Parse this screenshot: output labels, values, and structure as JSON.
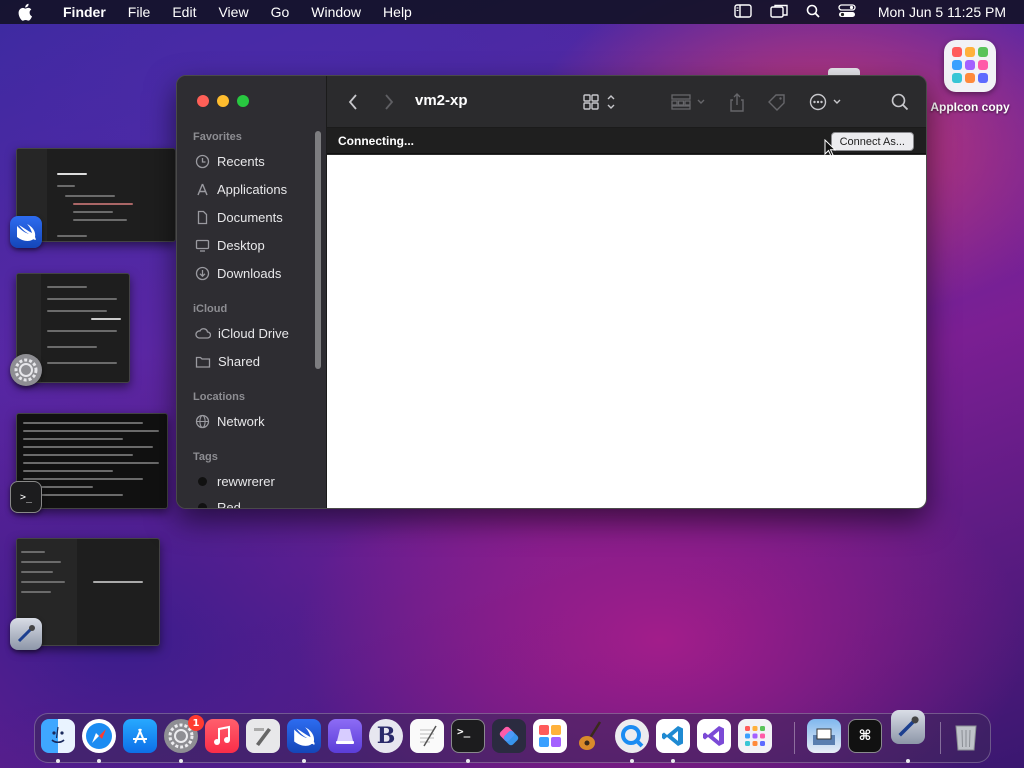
{
  "menubar": {
    "app_name": "Finder",
    "menus": [
      "File",
      "Edit",
      "View",
      "Go",
      "Window",
      "Help"
    ],
    "status_icons": [
      "sidebar-icon",
      "screen-mirror-icon",
      "search-icon",
      "control-center-icon"
    ],
    "clock": "Mon Jun 5  11:25 PM"
  },
  "desktop": {
    "icon_label": "AppIcon copy"
  },
  "finder": {
    "title": "vm2-xp",
    "sidebar": {
      "favorites_heading": "Favorites",
      "favorites": [
        {
          "label": "Recents",
          "icon": "clock-icon"
        },
        {
          "label": "Applications",
          "icon": "applications-icon"
        },
        {
          "label": "Documents",
          "icon": "document-icon"
        },
        {
          "label": "Desktop",
          "icon": "desktop-icon"
        },
        {
          "label": "Downloads",
          "icon": "download-icon"
        }
      ],
      "icloud_heading": "iCloud",
      "icloud": [
        {
          "label": "iCloud Drive",
          "icon": "cloud-icon"
        },
        {
          "label": "Shared",
          "icon": "shared-folder-icon"
        }
      ],
      "locations_heading": "Locations",
      "locations": [
        {
          "label": "Network",
          "icon": "globe-icon"
        }
      ],
      "tags_heading": "Tags",
      "tags": [
        {
          "label": "rewwrerer",
          "color": "#1a1a1a"
        },
        {
          "label": "Red",
          "color": "#1a1a1a"
        }
      ]
    },
    "status_text": "Connecting...",
    "connect_button": "Connect As..."
  },
  "colors": {
    "close": "#fe5f57",
    "minimize": "#febc2e",
    "zoom": "#28c840",
    "accent_blue": "#0a84ff"
  },
  "dock": {
    "settings_badge": "1",
    "apps": [
      "finder-icon",
      "safari-icon",
      "app-store-icon",
      "system-settings-icon",
      "music-icon",
      "script-editor-icon",
      "swift-icon",
      "launcher-icon",
      "bbedit-icon",
      "textedit-icon",
      "terminal-icon",
      "shortcuts-icon",
      "photo-booth-icon",
      "instruments-icon",
      "quicktime-icon",
      "vscode-icon",
      "visual-studio-icon",
      "launchpad-icon",
      "preview-icon",
      "keyboard-icon",
      "xcode-tools-icon",
      "trash-icon"
    ]
  }
}
